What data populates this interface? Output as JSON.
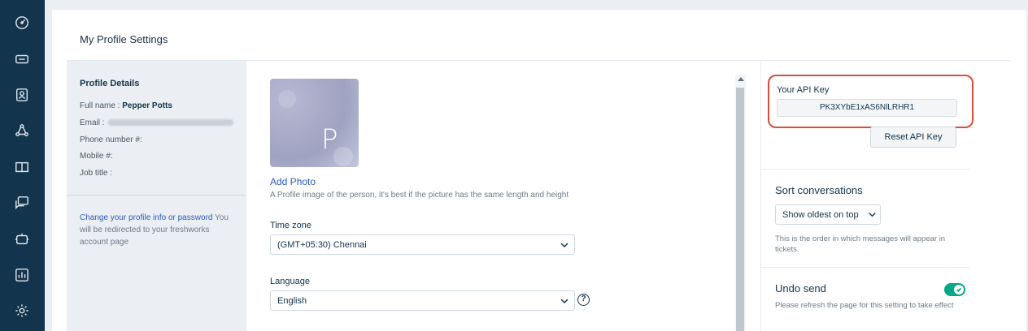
{
  "nav": {
    "icons": [
      "dashboard-icon",
      "tickets-icon",
      "contacts-icon",
      "groups-icon",
      "solutions-icon",
      "forums-icon",
      "bots-icon",
      "reports-icon",
      "admin-gear-icon"
    ]
  },
  "page": {
    "title": "My Profile Settings"
  },
  "profile_details": {
    "heading": "Profile Details",
    "full_name_label": "Full name :",
    "full_name_value": "Pepper Potts",
    "email_label": "Email :",
    "phone_label": "Phone number #:",
    "mobile_label": "Mobile #:",
    "job_title_label": "Job title :",
    "change_link": "Change your profile info or password",
    "change_note": " You will be redirected to your freshworks account page"
  },
  "photo": {
    "initial": "P",
    "add_label": "Add Photo",
    "hint": "A Profile image of the person, it's best if the picture has the same length and height"
  },
  "timezone": {
    "label": "Time zone",
    "value": "(GMT+05:30) Chennai"
  },
  "language": {
    "label": "Language",
    "value": "English",
    "help": "?"
  },
  "api": {
    "label": "Your API Key",
    "key": "PK3XYbE1xAS6NlLRHR1",
    "reset_label": "Reset API Key"
  },
  "sort": {
    "title": "Sort conversations",
    "value": "Show oldest on top",
    "hint": "This is the order in which messages will appear in tickets."
  },
  "undo": {
    "title": "Undo send",
    "enabled": true,
    "hint": "Please refresh the page for this setting to take effect"
  },
  "colors": {
    "nav_bg": "#12344d",
    "link": "#2c5cc5",
    "highlight": "#d94d3f",
    "toggle_on": "#00a886"
  }
}
